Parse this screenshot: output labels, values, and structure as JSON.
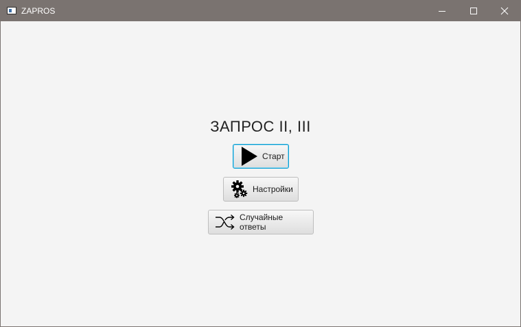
{
  "window": {
    "title": "ZAPROS",
    "icon": "app-window-icon",
    "controls": [
      "minimize-icon",
      "maximize-icon",
      "close-icon"
    ]
  },
  "main": {
    "heading": "ЗАПРОС II, III",
    "buttons": [
      {
        "label": "Старт",
        "icon": "play-icon",
        "focused": true
      },
      {
        "label": "Настройки",
        "icon": "gears-icon",
        "focused": false
      },
      {
        "label": "Случайные ответы",
        "icon": "shuffle-icon",
        "focused": false
      }
    ]
  },
  "colors": {
    "titlebar": "#7a7370",
    "background": "#f4f4f4",
    "focus_border": "#039ed3"
  }
}
